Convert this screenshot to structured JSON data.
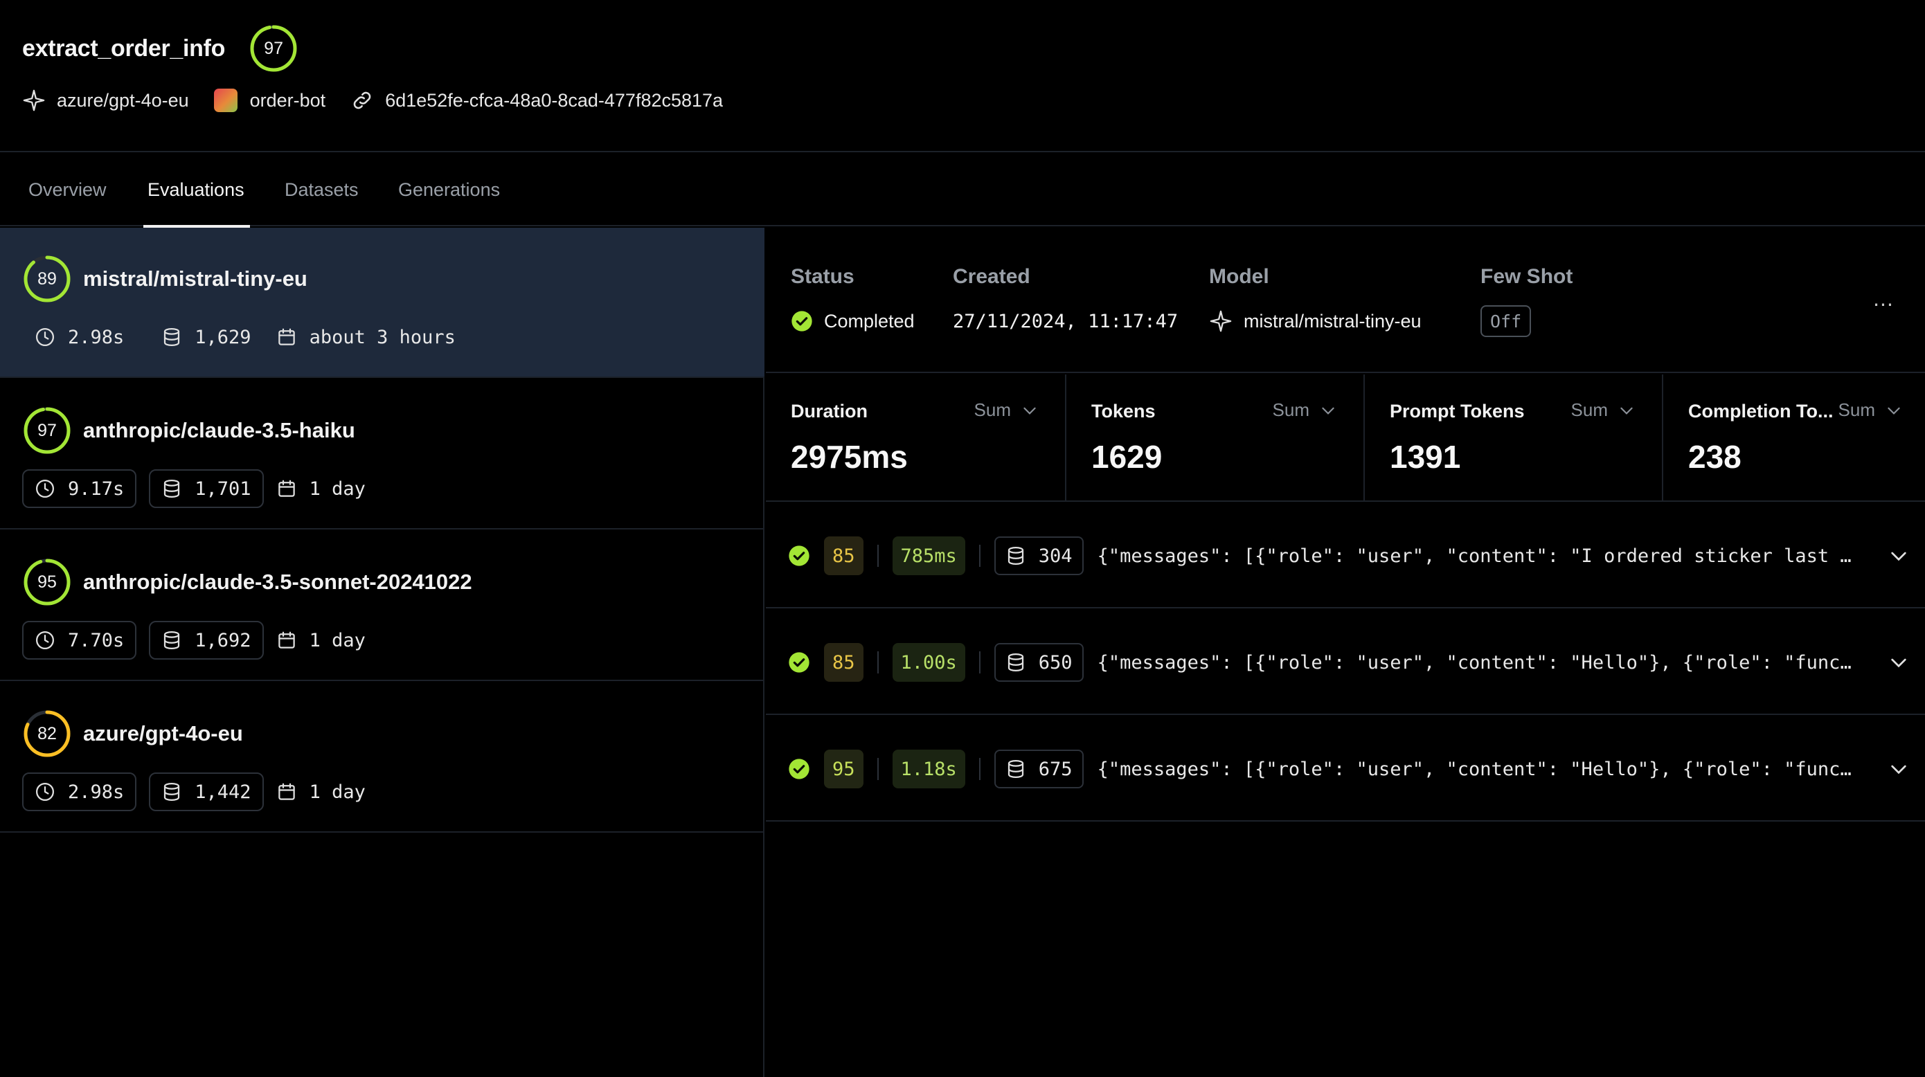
{
  "header": {
    "title": "extract_order_info",
    "score": 97,
    "model": "azure/gpt-4o-eu",
    "app": "order-bot",
    "id": "6d1e52fe-cfca-48a0-8cad-477f82c5817a"
  },
  "tabs": [
    {
      "label": "Overview"
    },
    {
      "label": "Evaluations"
    },
    {
      "label": "Datasets"
    },
    {
      "label": "Generations"
    }
  ],
  "active_tab": "Evaluations",
  "evaluations": [
    {
      "score": 89,
      "model": "mistral/mistral-tiny-eu",
      "duration": "2.98s",
      "tokens": "1,629",
      "age": "about 3 hours",
      "selected": true
    },
    {
      "score": 97,
      "model": "anthropic/claude-3.5-haiku",
      "duration": "9.17s",
      "tokens": "1,701",
      "age": "1 day"
    },
    {
      "score": 95,
      "model": "anthropic/claude-3.5-sonnet-20241022",
      "duration": "7.70s",
      "tokens": "1,692",
      "age": "1 day"
    },
    {
      "score": 82,
      "model": "azure/gpt-4o-eu",
      "duration": "2.98s",
      "tokens": "1,442",
      "age": "1 day"
    }
  ],
  "detail": {
    "status_label": "Status",
    "status_value": "Completed",
    "created_label": "Created",
    "created_value": "27/11/2024, 11:17:47",
    "model_label": "Model",
    "model_value": "mistral/mistral-tiny-eu",
    "fewshot_label": "Few Shot",
    "fewshot_value": "Off",
    "more_label": "..."
  },
  "metrics": [
    {
      "label": "Duration",
      "agg": "Sum",
      "value": "2975ms"
    },
    {
      "label": "Tokens",
      "agg": "Sum",
      "value": "1629"
    },
    {
      "label": "Prompt Tokens",
      "agg": "Sum",
      "value": "1391"
    },
    {
      "label": "Completion To...",
      "agg": "Sum",
      "value": "238"
    }
  ],
  "generations": [
    {
      "score": "85",
      "latency": "785ms",
      "tokens": "304",
      "text": "{\"messages\": [{\"role\": \"user\", \"content\": \"I ordered sticker last …"
    },
    {
      "score": "85",
      "latency": "1.00s",
      "tokens": "650",
      "text": "{\"messages\": [{\"role\": \"user\", \"content\": \"Hello\"}, {\"role\": \"functi…"
    },
    {
      "score": "95",
      "latency": "1.18s",
      "tokens": "675",
      "text": "{\"messages\": [{\"role\": \"user\", \"content\": \"Hello\"}, {\"role\": \"functi…"
    }
  ],
  "colors": {
    "accent_ring": "#a3e635",
    "warn_ring": "#fbbf24",
    "selected_bg": "#1e293b",
    "status_ok": "#a3e635"
  }
}
